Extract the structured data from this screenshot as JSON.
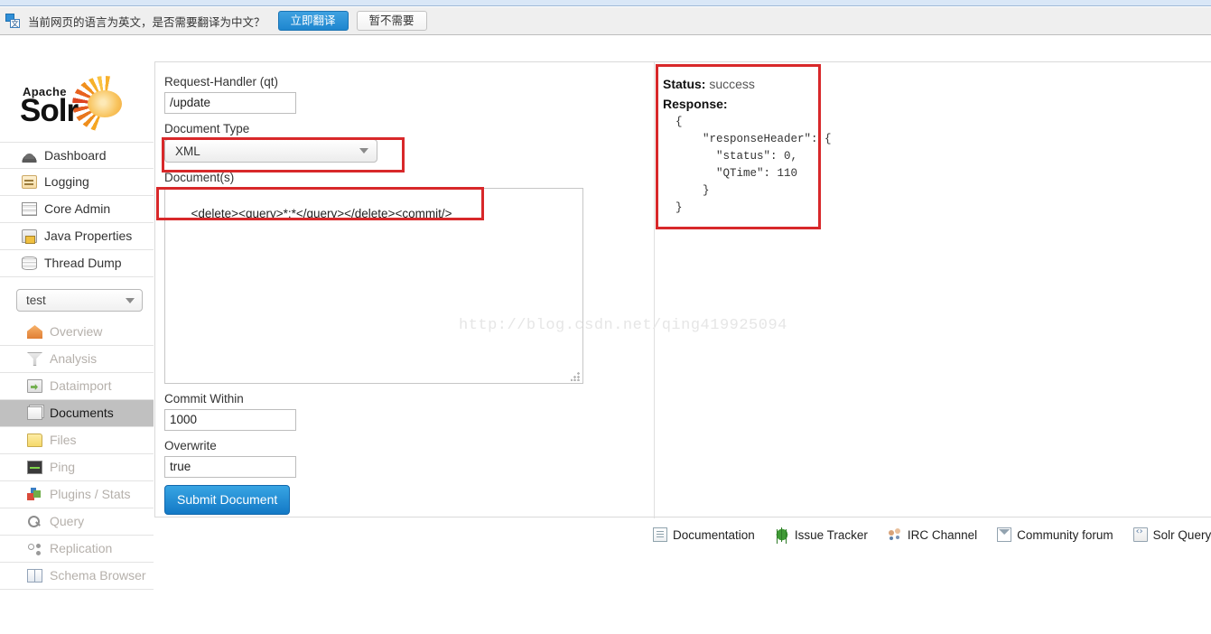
{
  "translate_bar": {
    "icon": "translate-icon",
    "message": "当前网页的语言为英文，是否需要翻译为中文？",
    "translate_now_label": "立即翻译",
    "translate_later_label": "暂不需要"
  },
  "sidebar": {
    "logo": {
      "apache": "Apache",
      "solr": "Solr"
    },
    "top_nav": [
      {
        "label": "Dashboard",
        "icon": "dashboard-icon"
      },
      {
        "label": "Logging",
        "icon": "logging-icon"
      },
      {
        "label": "Core Admin",
        "icon": "core-admin-icon"
      },
      {
        "label": "Java Properties",
        "icon": "java-properties-icon"
      },
      {
        "label": "Thread Dump",
        "icon": "thread-dump-icon"
      }
    ],
    "core_selector": {
      "value": "test",
      "icon": "chevron-down-icon"
    },
    "core_nav": [
      {
        "label": "Overview",
        "icon": "overview-icon",
        "active": false
      },
      {
        "label": "Analysis",
        "icon": "analysis-icon",
        "active": false
      },
      {
        "label": "Dataimport",
        "icon": "dataimport-icon",
        "active": false
      },
      {
        "label": "Documents",
        "icon": "documents-icon",
        "active": true
      },
      {
        "label": "Files",
        "icon": "files-icon",
        "active": false
      },
      {
        "label": "Ping",
        "icon": "ping-icon",
        "active": false
      },
      {
        "label": "Plugins / Stats",
        "icon": "plugins-icon",
        "active": false
      },
      {
        "label": "Query",
        "icon": "query-icon",
        "active": false
      },
      {
        "label": "Replication",
        "icon": "replication-icon",
        "active": false
      },
      {
        "label": "Schema Browser",
        "icon": "schema-browser-icon",
        "active": false
      }
    ]
  },
  "form": {
    "request_handler_label": "Request-Handler (qt)",
    "request_handler_value": "/update",
    "document_type_label": "Document Type",
    "document_type_value": "XML",
    "documents_label": "Document(s)",
    "documents_value": "<delete><query>*:*</query></delete><commit/>",
    "commit_within_label": "Commit Within",
    "commit_within_value": "1000",
    "overwrite_label": "Overwrite",
    "overwrite_value": "true",
    "submit_label": "Submit Document"
  },
  "response": {
    "status_label": "Status:",
    "status_value": "success",
    "response_label": "Response:",
    "body": "{\n    \"responseHeader\": {\n      \"status\": 0,\n      \"QTime\": 110\n    }\n}"
  },
  "watermark": "http://blog.csdn.net/qing419925094",
  "footer": {
    "links": [
      {
        "label": "Documentation",
        "icon": "document-icon"
      },
      {
        "label": "Issue Tracker",
        "icon": "bug-icon"
      },
      {
        "label": "IRC Channel",
        "icon": "people-icon"
      },
      {
        "label": "Community forum",
        "icon": "mail-icon"
      },
      {
        "label": "Solr Query",
        "icon": "code-icon"
      }
    ]
  },
  "annotations": {
    "accent_color": "#d8282a",
    "boxes": [
      "document-type",
      "documents",
      "response-panel"
    ]
  }
}
